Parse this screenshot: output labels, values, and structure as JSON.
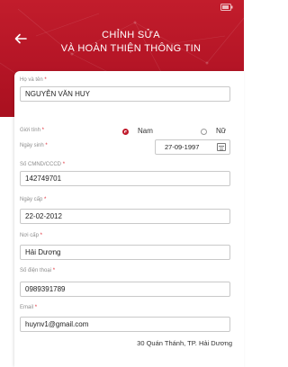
{
  "status": {
    "carrier": "",
    "time": "",
    "battery": ""
  },
  "header": {
    "back_icon": "arrow-left-icon",
    "title_line1": "CHỈNH SỬA",
    "title_line2": "VÀ HOÀN THIỆN THÔNG TIN"
  },
  "form": {
    "name_label": "Họ và tên",
    "name_value": "NGUYỄN VĂN HUY",
    "gender_label": "Giới tính",
    "gender_options": [
      "Nam",
      "Nữ"
    ],
    "gender_selected": "Nam",
    "dob_label": "Ngày sinh",
    "dob_value": "27-09-1997",
    "id_label": "Số CMND/CCCD",
    "id_value": "142749701",
    "issue_date_label": "Ngày cấp",
    "issue_date_value": "22-02-2012",
    "issue_place_label": "Nơi cấp",
    "issue_place_value": "Hải Dương",
    "phone_label": "Số điện thoại",
    "phone_value": "0989391789",
    "email_label": "Email",
    "email_value": "huynv1@gmail.com",
    "address_value": "30 Quán Thánh, TP. Hải Dương",
    "required_mark": "*"
  },
  "colors": {
    "brand_red": "#b51526",
    "accent": "#c0192a",
    "required": "#e02a35"
  }
}
